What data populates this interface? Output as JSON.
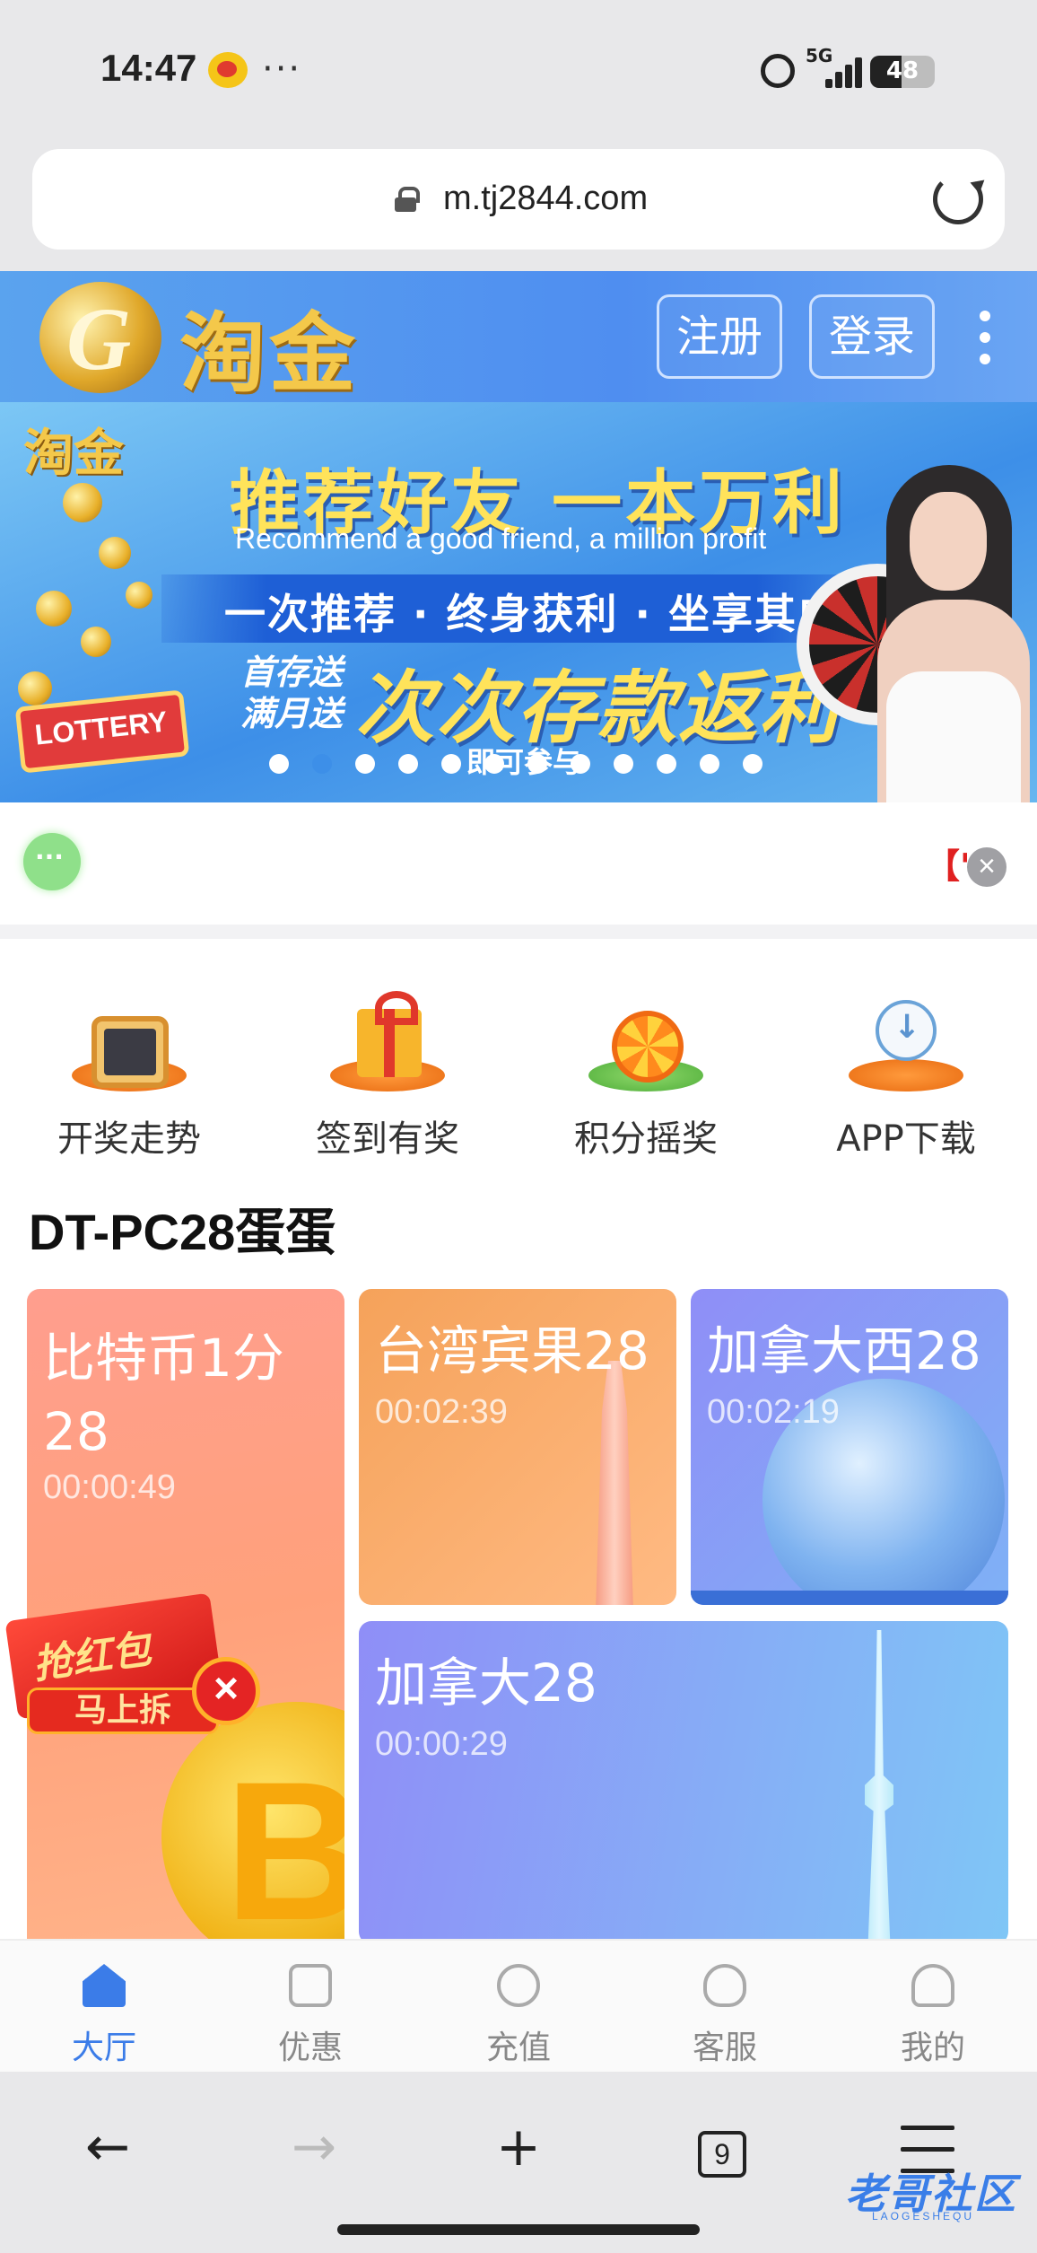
{
  "status_bar": {
    "time": "14:47",
    "more": "···",
    "network": "5G",
    "battery": "48",
    "battery_level": 0.48
  },
  "browser": {
    "url": "m.tj2844.com",
    "tab_count": "9"
  },
  "header": {
    "logo_text": "淘金",
    "register_label": "注册",
    "login_label": "登录"
  },
  "banner": {
    "logo_text": "淘金",
    "title": "推荐好友  一本万利",
    "subtitle": "Recommend a good friend, a million profit",
    "ribbon": "一次推荐 · 终身获利 · 坐享其成",
    "small_line1": "首存送",
    "small_line2": "满月送",
    "big": "次次存款返利",
    "bottom": "即可参与",
    "lottery_sign": "LOTTERY",
    "slide_count": 12,
    "active_slide": 1
  },
  "notice": {
    "text": "【'"
  },
  "shortcuts": [
    {
      "label": "开奖走势"
    },
    {
      "label": "签到有奖"
    },
    {
      "label": "积分摇奖"
    },
    {
      "label": "APP下载"
    }
  ],
  "section": {
    "title": "DT-PC28蛋蛋"
  },
  "games": {
    "bitcoin": {
      "name": "比特币1分28",
      "timer": "00:00:49"
    },
    "taiwan": {
      "name": "台湾宾果28",
      "timer": "00:02:39"
    },
    "canada_west": {
      "name": "加拿大西28",
      "timer": "00:02:19"
    },
    "canada": {
      "name": "加拿大28",
      "timer": "00:00:29"
    }
  },
  "redpacket": {
    "title": "抢红包",
    "button": "马上拆"
  },
  "bottom_nav": [
    {
      "label": "大厅",
      "icon": "home-icon",
      "active": true
    },
    {
      "label": "优惠",
      "icon": "coupon-icon",
      "active": false
    },
    {
      "label": "充值",
      "icon": "recharge-icon",
      "active": false
    },
    {
      "label": "客服",
      "icon": "support-icon",
      "active": false
    },
    {
      "label": "我的",
      "icon": "profile-icon",
      "active": false
    }
  ],
  "watermark": {
    "text": "老哥社区",
    "sub": "LAOGESHEQU"
  },
  "colors": {
    "accent": "#3b7ce8",
    "header_bg": "#5aa3ee",
    "notice_red": "#e02020"
  }
}
